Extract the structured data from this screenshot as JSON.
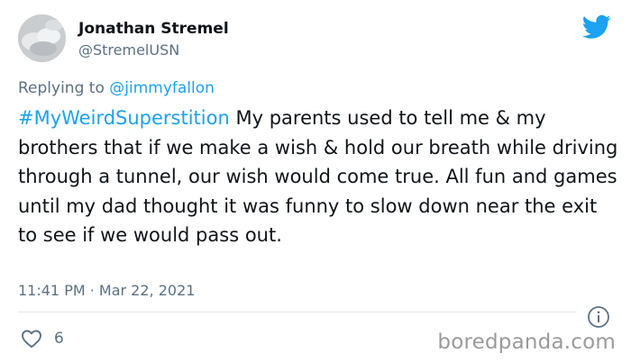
{
  "author": {
    "name": "Jonathan Stremel",
    "handle": "@StremelUSN"
  },
  "reply": {
    "prefix": "Replying to ",
    "mention": "@jimmyfallon"
  },
  "tweet": {
    "hashtag": "#MyWeirdSuperstition",
    "text": " My parents used to tell me & my brothers that if we make a wish & hold our breath while driving through a tunnel, our wish would come true. All fun and games until my dad thought it was funny to slow down near the exit to see if we would pass out."
  },
  "meta": {
    "timestamp": "11:41 PM · Mar 22, 2021"
  },
  "actions": {
    "like_count": "6"
  },
  "watermark": "boredpanda.com",
  "colors": {
    "accent": "#1da1f2",
    "muted": "#5b7083",
    "text": "#0f1419"
  },
  "icons": [
    "twitter-bird-icon",
    "info-icon",
    "heart-icon"
  ]
}
